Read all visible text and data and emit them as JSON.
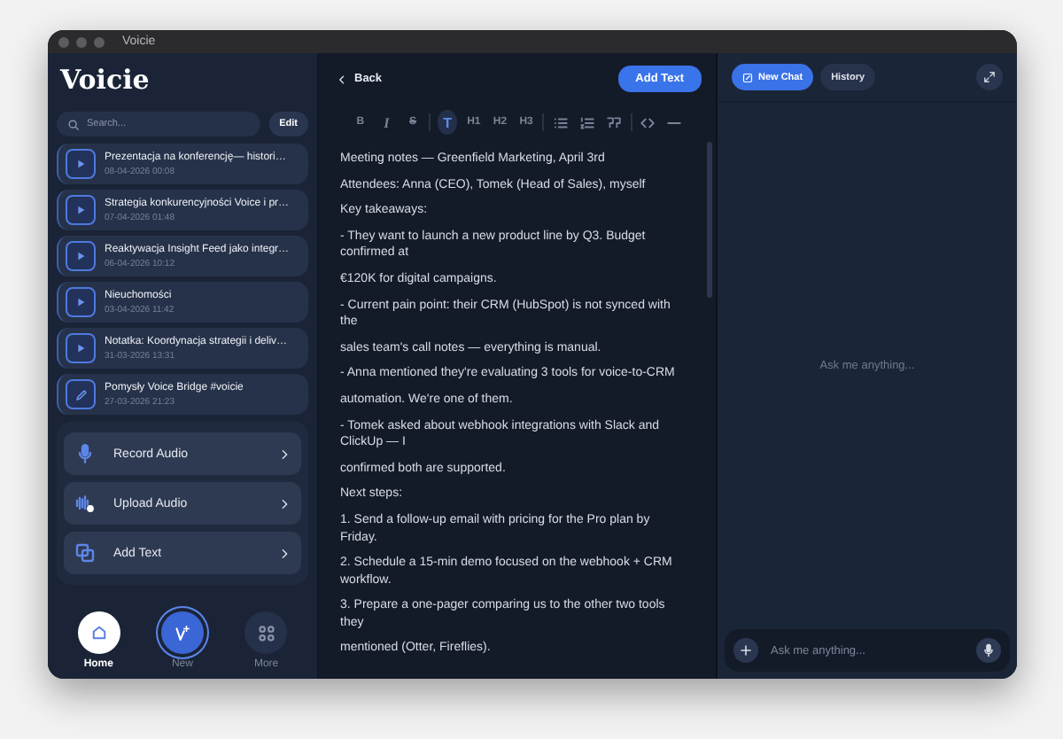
{
  "window": {
    "title": "Voicie"
  },
  "sidebar": {
    "logo": "Voicie",
    "search": {
      "placeholder": "Search..."
    },
    "edit_button": "Edit",
    "notes": [
      {
        "kind": "audio",
        "title": "Prezentacja na konferencję— histori…",
        "date": "08-04-2026 00:08"
      },
      {
        "kind": "audio",
        "title": "Strategia konkurencyjności Voice i pr…",
        "date": "07-04-2026 01:48"
      },
      {
        "kind": "audio",
        "title": "Reaktywacja Insight Feed jako integr…",
        "date": "06-04-2026 10:12"
      },
      {
        "kind": "audio",
        "title": "Nieuchomości",
        "date": "03-04-2026 11:42"
      },
      {
        "kind": "audio",
        "title": "Notatka: Koordynacja strategii i deliv…",
        "date": "31-03-2026 13:31"
      },
      {
        "kind": "text",
        "title": "Pomysły Voice Bridge #voicie",
        "date": "27-03-2026 21:23"
      }
    ],
    "actions": [
      {
        "kind": "record",
        "label": "Record Audio"
      },
      {
        "kind": "upload",
        "label": "Upload Audio"
      },
      {
        "kind": "text",
        "label": "Add Text"
      }
    ],
    "nav": [
      {
        "kind": "home",
        "label": "Home",
        "selected": true
      },
      {
        "kind": "new",
        "label": "New",
        "selected": false
      },
      {
        "kind": "more",
        "label": "More",
        "selected": false
      }
    ]
  },
  "editor": {
    "back": "Back",
    "add_button": "Add Text",
    "toolbar": [
      {
        "kind": "bold",
        "label": "B",
        "selected": false
      },
      {
        "kind": "italic",
        "label": "I",
        "selected": false
      },
      {
        "kind": "strike",
        "label": "S",
        "selected": false
      },
      {
        "kind": "divider"
      },
      {
        "kind": "paragraph",
        "label": "T",
        "selected": true
      },
      {
        "kind": "heading",
        "label": "H1",
        "selected": false
      },
      {
        "kind": "heading",
        "label": "H2",
        "selected": false
      },
      {
        "kind": "heading",
        "label": "H3",
        "selected": false
      },
      {
        "kind": "divider"
      },
      {
        "kind": "bullet-list",
        "selected": false
      },
      {
        "kind": "ordered-list",
        "selected": false
      },
      {
        "kind": "quote",
        "selected": false
      },
      {
        "kind": "divider"
      },
      {
        "kind": "code",
        "selected": false
      },
      {
        "kind": "rule",
        "selected": false
      }
    ],
    "paragraphs": [
      "Meeting notes — Greenfield Marketing, April 3rd",
      "Attendees: Anna (CEO), Tomek (Head of Sales), myself",
      "Key takeaways:",
      "- They want to launch a new product line by Q3. Budget confirmed at",
      "€120K for digital campaigns.",
      "- Current pain point: their CRM (HubSpot) is not synced with the",
      "sales team's call notes — everything is manual.",
      "- Anna mentioned they're evaluating 3 tools for voice-to-CRM",
      "automation. We're one of them.",
      "- Tomek asked about webhook integrations with Slack and ClickUp — I",
      "confirmed both are supported.",
      "Next steps:",
      "1. Send a follow-up email with pricing for the Pro plan by Friday.",
      "2. Schedule a 15-min demo focused on the webhook + CRM workflow.",
      "3. Prepare a one-pager comparing us to the other two tools they",
      "mentioned (Otter, Fireflies)."
    ]
  },
  "chat": {
    "tabs": [
      {
        "label": "New Chat",
        "selected": true
      },
      {
        "label": "History",
        "selected": false
      }
    ],
    "empty_text": "Ask me anything...",
    "input": {
      "placeholder": "Ask me anything..."
    }
  }
}
